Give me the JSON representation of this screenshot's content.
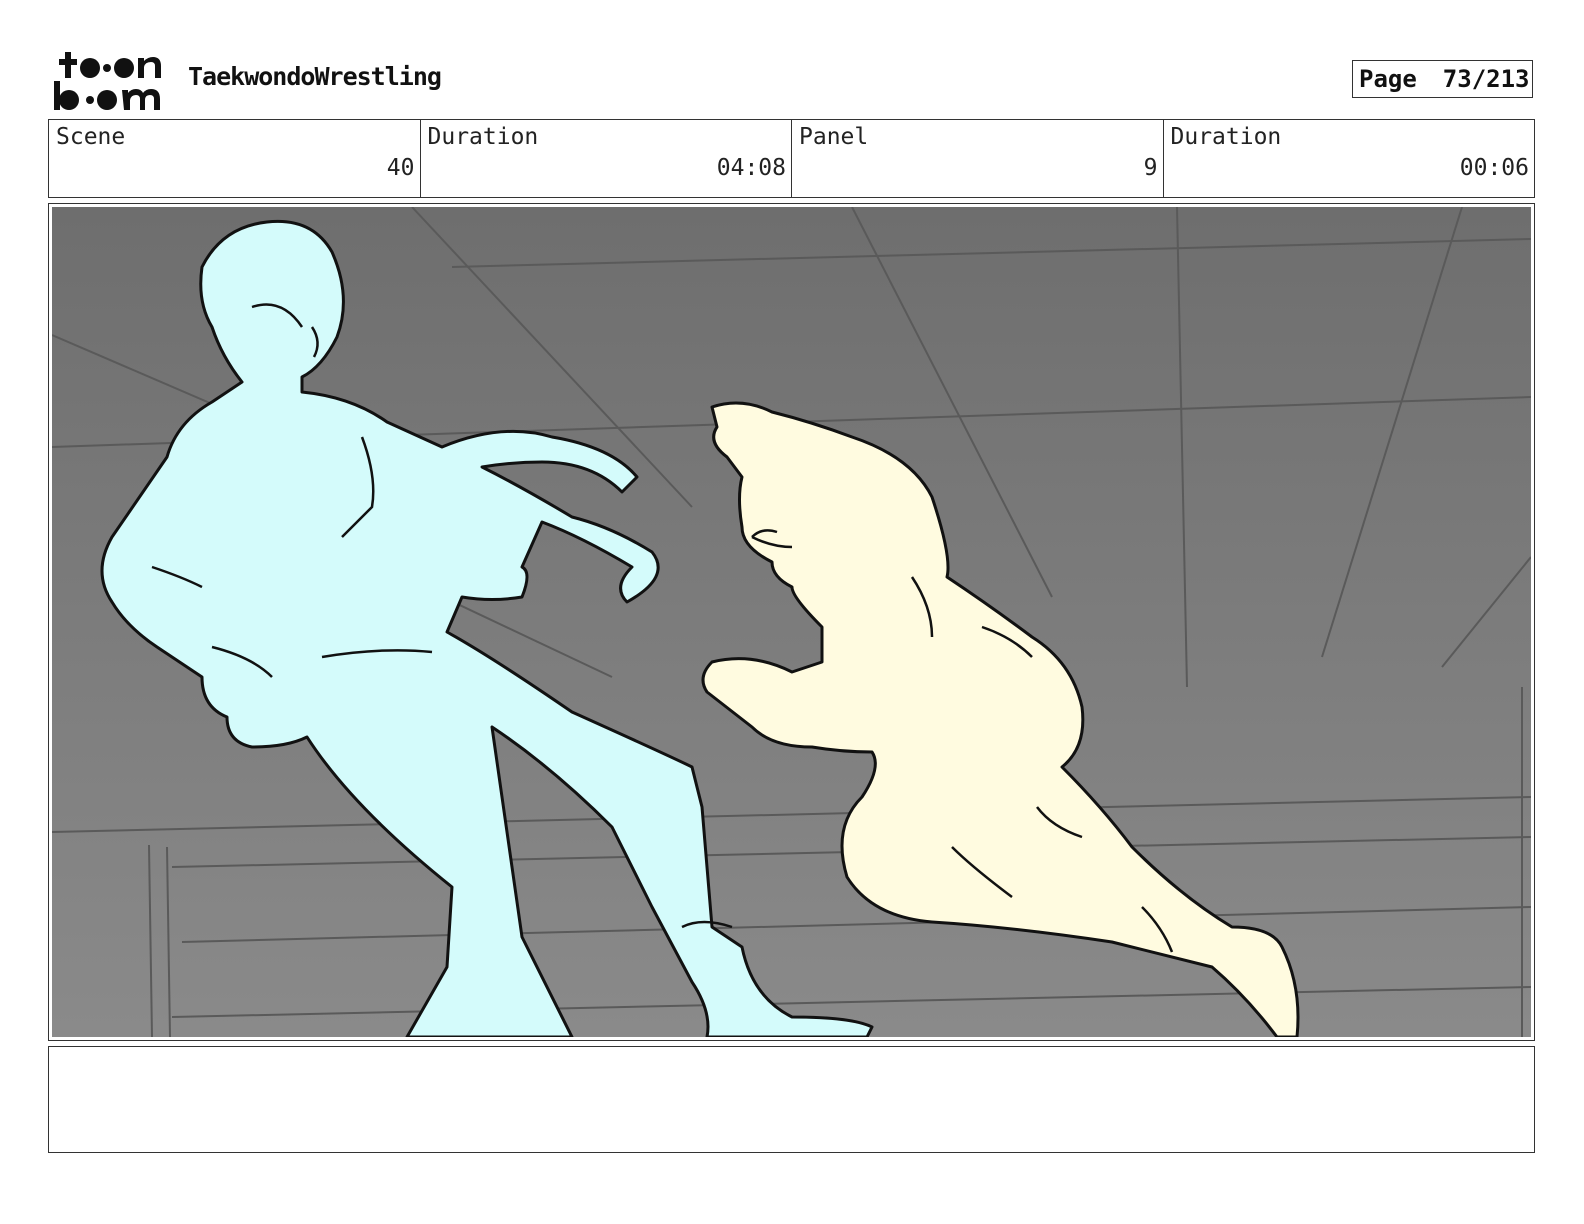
{
  "header": {
    "logo_line1": "t••n",
    "logo_line2": "b••m",
    "project_title": "TaekwondoWrestling",
    "page_label": "Page",
    "page_number": "73/213"
  },
  "info": {
    "scene_label": "Scene",
    "scene_value": "40",
    "scene_duration_label": "Duration",
    "scene_duration_value": "04:08",
    "panel_label": "Panel",
    "panel_value": "9",
    "panel_duration_label": "Duration",
    "panel_duration_value": "00:06"
  },
  "notes": {
    "text": ""
  },
  "colors": {
    "background_gray": "#7a7a7a",
    "character_left_fill": "#d4fbfb",
    "character_right_fill": "#fffbe0",
    "line": "#111111"
  }
}
